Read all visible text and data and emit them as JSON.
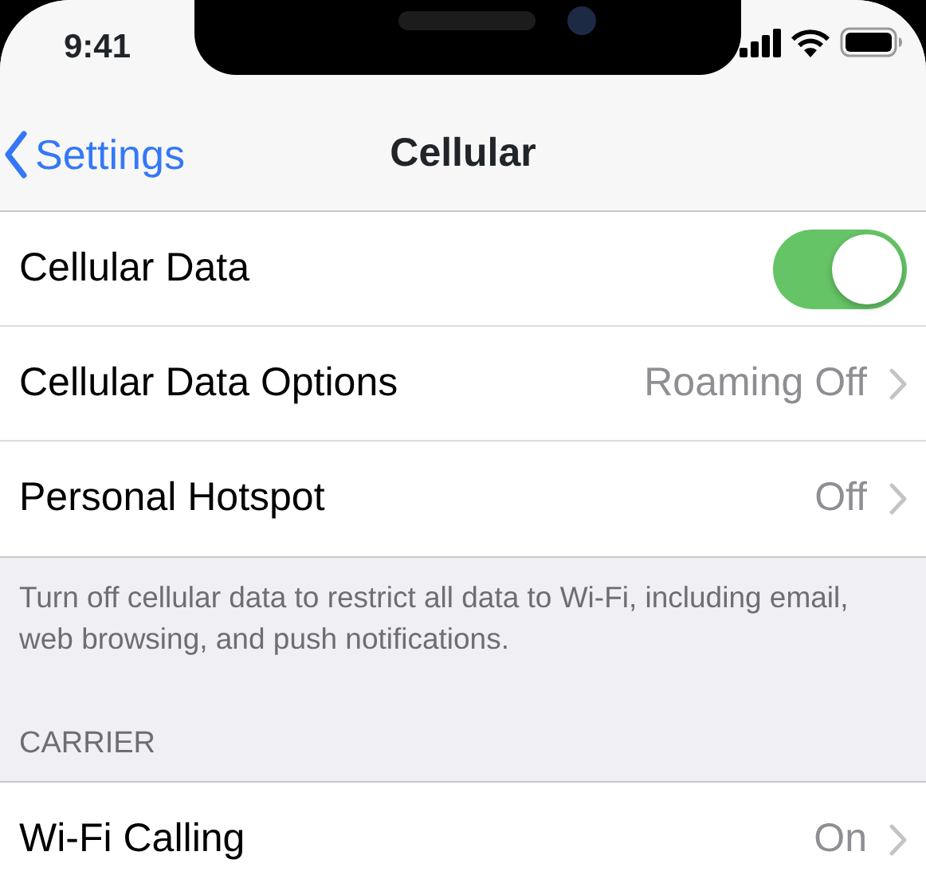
{
  "status_bar": {
    "time": "9:41"
  },
  "nav": {
    "back": "Settings",
    "title": "Cellular"
  },
  "rows": [
    {
      "kind": "toggle",
      "label": "Cellular Data",
      "on": true
    },
    {
      "kind": "detail",
      "label": "Cellular Data Options",
      "value": "Roaming Off"
    },
    {
      "kind": "detail",
      "label": "Personal Hotspot",
      "value": "Off"
    }
  ],
  "footer": "Turn off cellular data to restrict all data to Wi-Fi, including email, web browsing, and push notifications.",
  "section": {
    "header": "CARRIER",
    "rows": [
      {
        "kind": "detail",
        "label": "Wi-Fi Calling",
        "value": "On"
      }
    ]
  }
}
